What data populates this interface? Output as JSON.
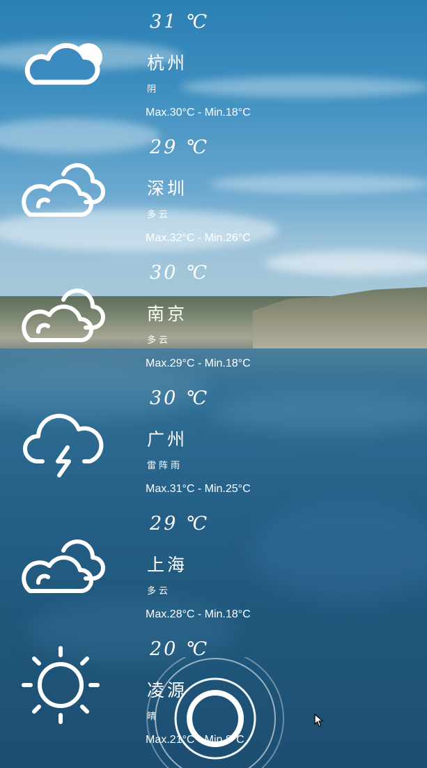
{
  "cities": [
    {
      "temp": "31 ℃",
      "name": "杭州",
      "condition": "阴",
      "range": "Max.30°C - Min.18°C",
      "icon": "cloud-sun-icon"
    },
    {
      "temp": "29 ℃",
      "name": "深圳",
      "condition": "多云",
      "range": "Max.32°C - Min.26°C",
      "icon": "cloudy-icon"
    },
    {
      "temp": "30 ℃",
      "name": "南京",
      "condition": "多云",
      "range": "Max.29°C - Min.18°C",
      "icon": "cloudy-icon"
    },
    {
      "temp": "30 ℃",
      "name": "广州",
      "condition": "雷阵雨",
      "range": "Max.31°C - Min.25°C",
      "icon": "thunderstorm-icon"
    },
    {
      "temp": "29 ℃",
      "name": "上海",
      "condition": "多云",
      "range": "Max.28°C - Min.18°C",
      "icon": "cloudy-icon"
    },
    {
      "temp": "20 ℃",
      "name": "凌源",
      "condition": "晴",
      "range": "Max.21°C - Min.8°C",
      "icon": "sun-icon"
    }
  ],
  "colors": {
    "text": "#ffffff",
    "sky": "#2a7fb3",
    "water": "#1f5679"
  }
}
